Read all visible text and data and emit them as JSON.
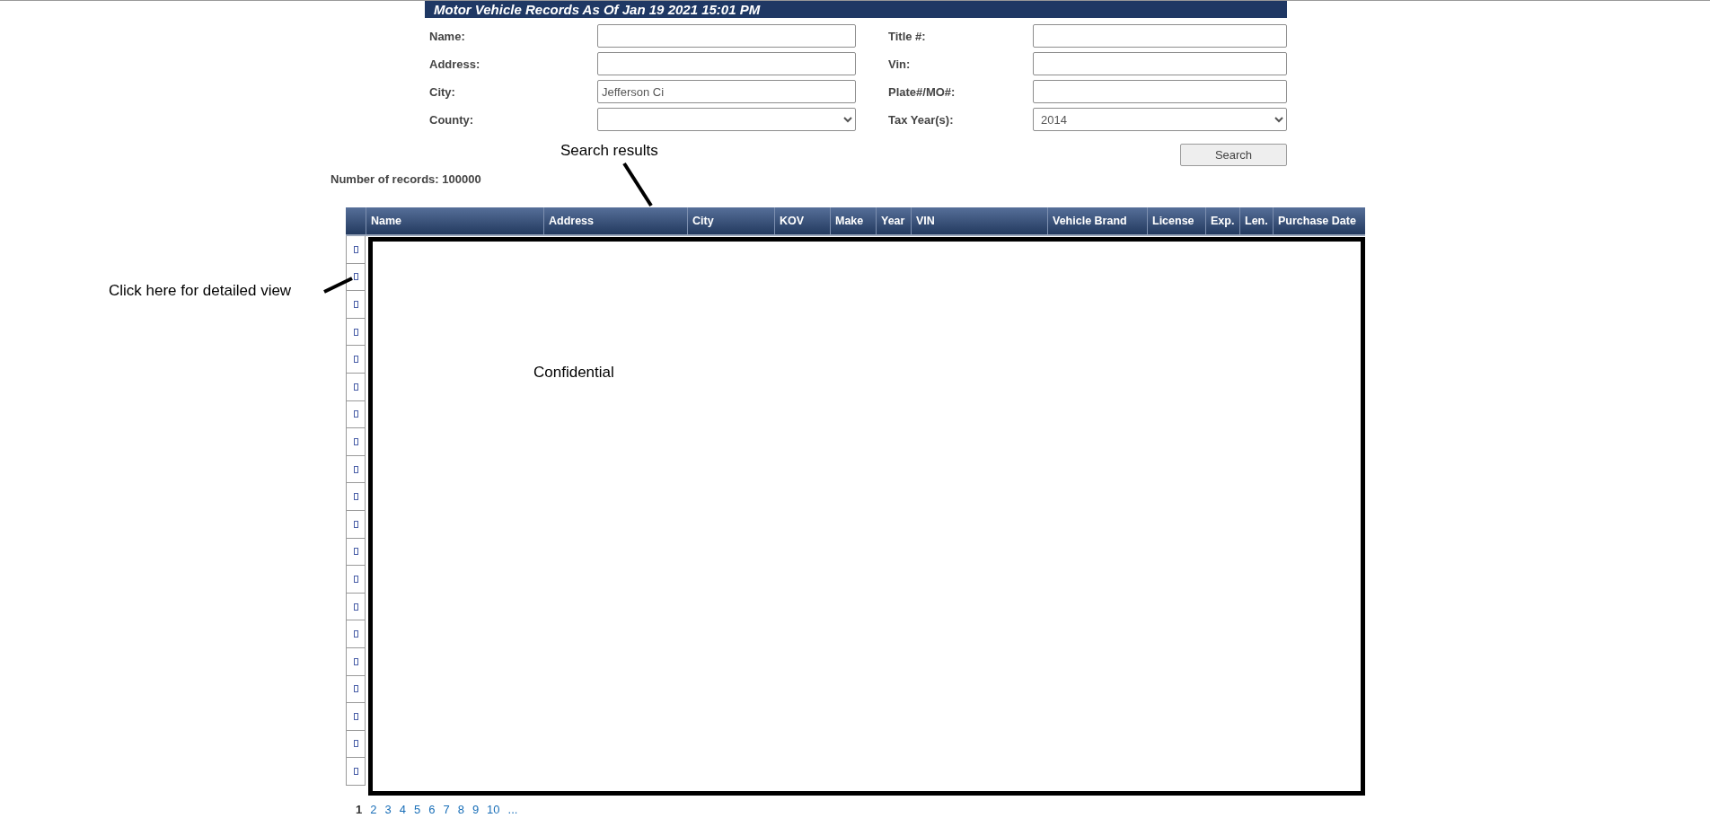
{
  "header": {
    "title": "Motor Vehicle Records As Of Jan 19 2021 15:01 PM"
  },
  "form": {
    "fields": [
      {
        "label": "Name:",
        "kind": "text"
      },
      {
        "label": "Title #:",
        "kind": "text"
      },
      {
        "label": "Address:",
        "kind": "text"
      },
      {
        "label": "Vin:",
        "kind": "text"
      },
      {
        "label": "City:",
        "kind": "text",
        "value": "Jefferson Ci"
      },
      {
        "label": "Plate#/MO#:",
        "kind": "text"
      },
      {
        "label": "County:",
        "kind": "select"
      },
      {
        "label": "Tax Year(s):",
        "kind": "select",
        "value": "2014"
      }
    ],
    "search_button": "Search"
  },
  "record_count": "Number of records: 100000",
  "table": {
    "columns": [
      "Name",
      "Address",
      "City",
      "KOV",
      "Make",
      "Year",
      "VIN",
      "Vehicle Brand",
      "License",
      "Exp.",
      "Len.",
      "Purchase Date"
    ],
    "rows": [
      {
        "detail_icon": true
      },
      {
        "detail_icon": true
      },
      {
        "detail_icon": true
      },
      {
        "detail_icon": true
      },
      {
        "detail_icon": true
      },
      {
        "detail_icon": true
      },
      {
        "detail_icon": true
      },
      {
        "detail_icon": true
      },
      {
        "detail_icon": true
      },
      {
        "detail_icon": true
      },
      {
        "detail_icon": true
      },
      {
        "detail_icon": true
      },
      {
        "detail_icon": true
      },
      {
        "detail_icon": true
      },
      {
        "detail_icon": true
      },
      {
        "detail_icon": true
      },
      {
        "detail_icon": true
      },
      {
        "detail_icon": true
      },
      {
        "detail_icon": true
      },
      {
        "detail_icon": true
      }
    ],
    "overlay_text": "Confidential"
  },
  "pagination": [
    {
      "label": "1",
      "selected": true
    },
    {
      "label": "2",
      "selected": false
    },
    {
      "label": "3",
      "selected": false
    },
    {
      "label": "4",
      "selected": false
    },
    {
      "label": "5",
      "selected": false
    },
    {
      "label": "6",
      "selected": false
    },
    {
      "label": "7",
      "selected": false
    },
    {
      "label": "8",
      "selected": false
    },
    {
      "label": "9",
      "selected": false
    },
    {
      "label": "10",
      "selected": false
    },
    {
      "label": "...",
      "selected": false
    }
  ],
  "annotations": [
    {
      "kind": "search",
      "text": "Search results"
    },
    {
      "kind": "detail",
      "text": "Click here for detailed view"
    }
  ]
}
